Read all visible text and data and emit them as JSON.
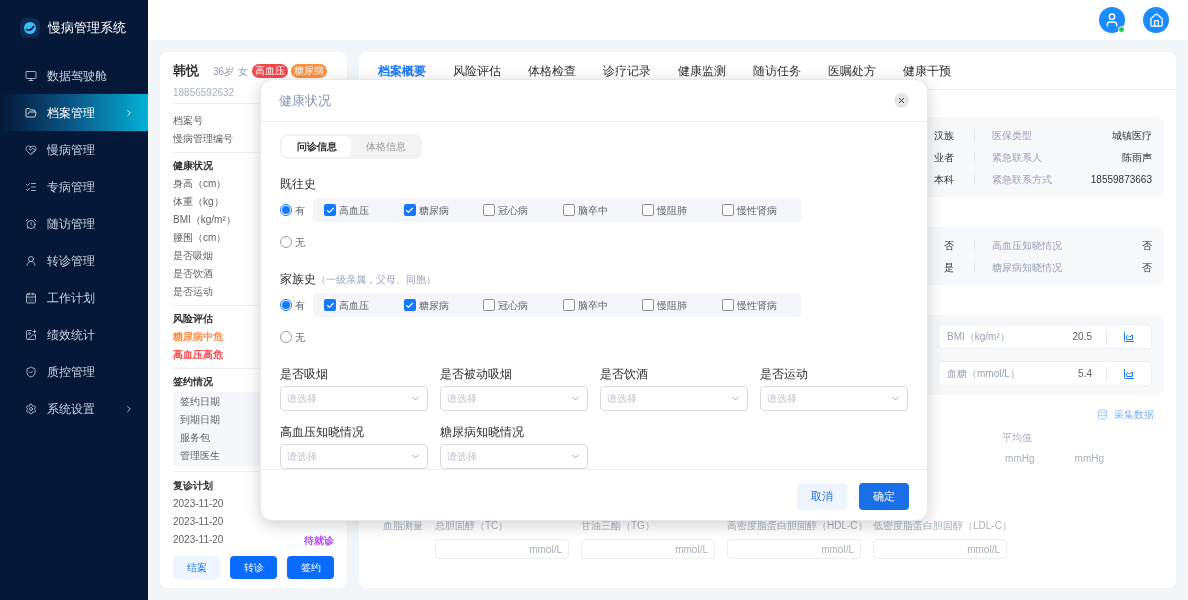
{
  "app": {
    "title": "慢病管理系统"
  },
  "sidebar": {
    "items": [
      {
        "label": "数据驾驶舱",
        "selected": false,
        "has_children": false
      },
      {
        "label": "档案管理",
        "selected": true,
        "has_children": true
      },
      {
        "label": "慢病管理",
        "selected": false,
        "has_children": false
      },
      {
        "label": "专病管理",
        "selected": false,
        "has_children": false
      },
      {
        "label": "随访管理",
        "selected": false,
        "has_children": false
      },
      {
        "label": "转诊管理",
        "selected": false,
        "has_children": false
      },
      {
        "label": "工作计划",
        "selected": false,
        "has_children": false
      },
      {
        "label": "绩效统计",
        "selected": false,
        "has_children": false
      },
      {
        "label": "质控管理",
        "selected": false,
        "has_children": false
      },
      {
        "label": "系统设置",
        "selected": false,
        "has_children": true
      }
    ]
  },
  "patient": {
    "name": "韩悦",
    "age": "36岁",
    "gender": "女",
    "phone": "18856592632",
    "tags": [
      {
        "label": "高血压",
        "color": "#f5474b"
      },
      {
        "label": "糖尿病",
        "color": "#ff8d3a"
      }
    ],
    "ids": [
      "档案号",
      "慢病管理编号"
    ],
    "health": {
      "title": "健康状况",
      "items": [
        "身高（cm）",
        "体重（kg）",
        "BMI（kg/m²）",
        "腰围（cm）",
        "是否吸烟",
        "是否饮酒",
        "是否运动"
      ]
    },
    "risk": {
      "title": "风险评估",
      "items": [
        {
          "label": "糖尿病中危",
          "color": "#ff8d4a"
        },
        {
          "label": "高血压高危",
          "color": "#f5474b"
        }
      ]
    },
    "contract": {
      "title": "签约情况",
      "items": [
        "签约日期",
        "到期日期",
        "服务包",
        "管理医生"
      ]
    },
    "revisit": {
      "title": "复诊计划",
      "rows": [
        {
          "date": "2023-11-20"
        },
        {
          "date": "2023-11-20"
        },
        {
          "date": "2023-11-20",
          "status": "待就诊",
          "color": "#b44af5"
        }
      ]
    },
    "buttons": [
      {
        "label": "结案",
        "kind": "secondary"
      },
      {
        "label": "转诊",
        "kind": "primary"
      },
      {
        "label": "签约",
        "kind": "primary"
      }
    ]
  },
  "tabs": [
    {
      "label": "档案概要",
      "selected": true
    },
    {
      "label": "风险评估",
      "selected": false
    },
    {
      "label": "体格检查",
      "selected": false
    },
    {
      "label": "诊疗记录",
      "selected": false
    },
    {
      "label": "健康监测",
      "selected": false
    },
    {
      "label": "随访任务",
      "selected": false
    },
    {
      "label": "医嘱处方",
      "selected": false
    },
    {
      "label": "健康干预",
      "selected": false
    }
  ],
  "overview": {
    "info_rows": [
      {
        "cut_value": "汉族",
        "label": "医保类型",
        "value": "城镇医疗"
      },
      {
        "cut_value": "业者",
        "label": "紧急联系人",
        "value": "陈雨声"
      },
      {
        "cut_value": "本科",
        "label": "紧急联系方式",
        "value": "18559873663"
      }
    ],
    "habit_rows": [
      {
        "cut_value": "否",
        "label": "高血压知晓情况",
        "value": "否"
      },
      {
        "cut_value": "是",
        "label": "糖尿病知晓情况",
        "value": "否"
      }
    ],
    "measures": [
      {
        "label": "BMI（kg/m²）",
        "value": "20.5"
      },
      {
        "label": "血糖（mmol/L）",
        "value": "5.4"
      }
    ],
    "collect_link": "采集数据",
    "average_label": "平均值",
    "average_units": [
      "mmHg",
      "mmHg"
    ],
    "lipids": {
      "title": "血脂测量",
      "items": [
        {
          "label": "总胆固醇（TC）",
          "unit": "mmol/L"
        },
        {
          "label": "甘油三酯（TG）",
          "unit": "mmol/L"
        },
        {
          "label": "高密度脂蛋白胆固醇（HDL-C）",
          "unit": "mmol/L"
        },
        {
          "label": "低密度脂蛋白胆固醇（LDL-C）",
          "unit": "mmol/L"
        }
      ]
    }
  },
  "modal": {
    "title": "健康状况",
    "tabs": [
      {
        "label": "问诊信息",
        "selected": true
      },
      {
        "label": "体格信息",
        "selected": false
      }
    ],
    "histories": [
      {
        "label": "既往史",
        "options": [
          {
            "label": "有",
            "selected": true,
            "diseases": [
              {
                "label": "高血压",
                "checked": true
              },
              {
                "label": "糖尿病",
                "checked": true
              },
              {
                "label": "冠心病",
                "checked": false
              },
              {
                "label": "脑卒中",
                "checked": false
              },
              {
                "label": "慢阻肺",
                "checked": false
              },
              {
                "label": "慢性肾病",
                "checked": false
              }
            ]
          },
          {
            "label": "无",
            "selected": false
          }
        ]
      },
      {
        "label": "家族史",
        "hint": "（一级亲属，父母、同胞）",
        "options": [
          {
            "label": "有",
            "selected": true,
            "diseases": [
              {
                "label": "高血压",
                "checked": true
              },
              {
                "label": "糖尿病",
                "checked": true
              },
              {
                "label": "冠心病",
                "checked": false
              },
              {
                "label": "脑卒中",
                "checked": false
              },
              {
                "label": "慢阻肺",
                "checked": false
              },
              {
                "label": "慢性肾病",
                "checked": false
              }
            ]
          },
          {
            "label": "无",
            "selected": false
          }
        ]
      }
    ],
    "selects": [
      {
        "label": "是否吸烟",
        "placeholder": "请选择"
      },
      {
        "label": "是否被动吸烟",
        "placeholder": "请选择"
      },
      {
        "label": "是否饮酒",
        "placeholder": "请选择"
      },
      {
        "label": "是否运动",
        "placeholder": "请选择"
      },
      {
        "label": "高血压知晓情况",
        "placeholder": "请选择"
      },
      {
        "label": "糖尿病知晓情况",
        "placeholder": "请选择"
      }
    ],
    "buttons": [
      {
        "label": "取消",
        "kind": "secondary"
      },
      {
        "label": "确定",
        "kind": "primary"
      }
    ]
  }
}
